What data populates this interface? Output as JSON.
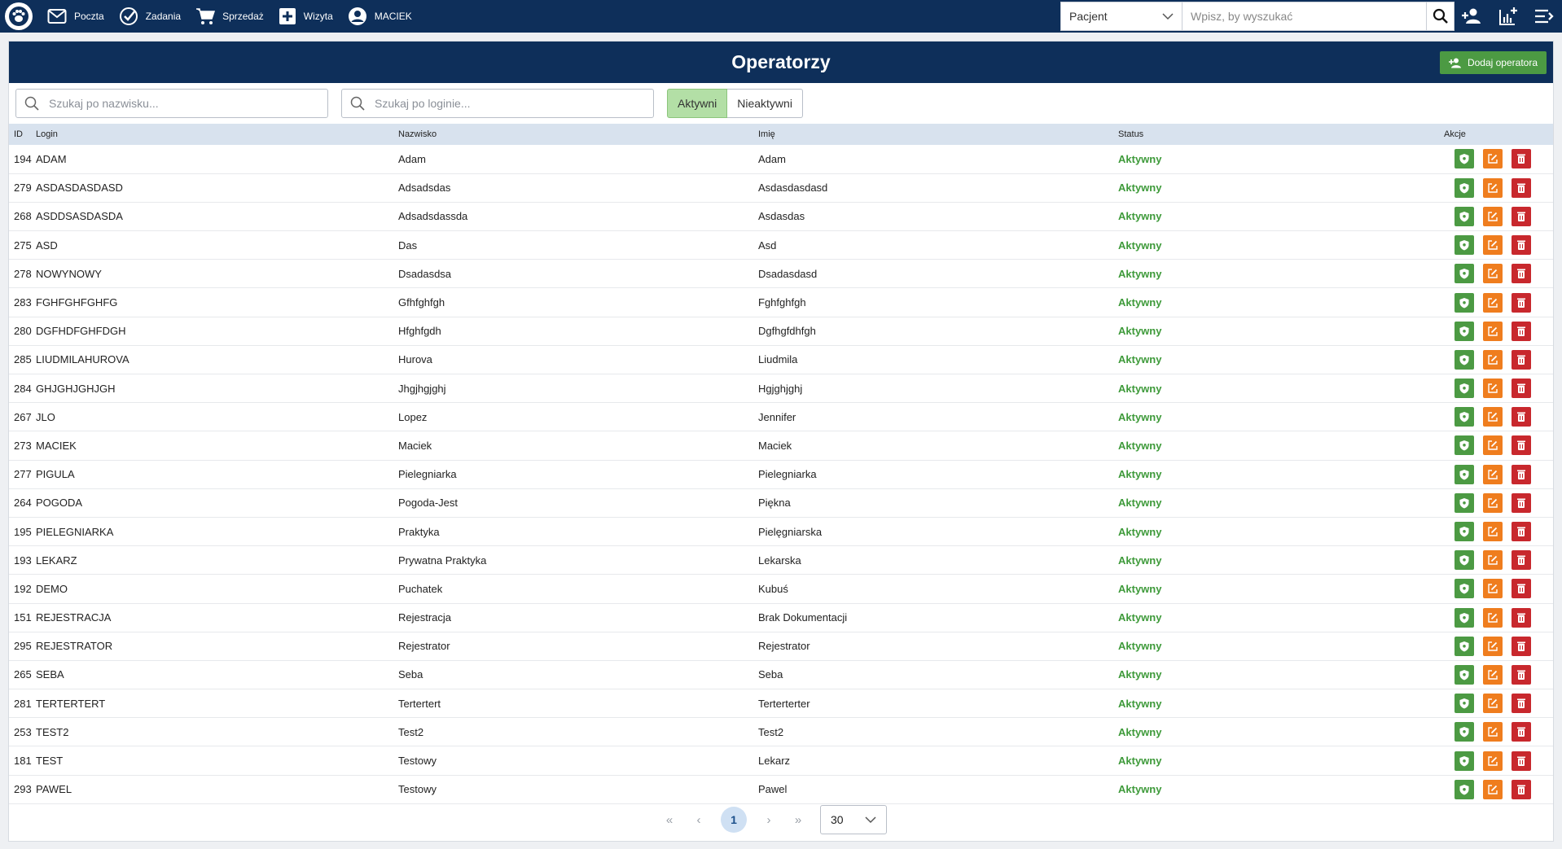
{
  "nav": {
    "items": [
      {
        "label": "Poczta",
        "icon": "mail-icon"
      },
      {
        "label": "Zadania",
        "icon": "check-circle-icon"
      },
      {
        "label": "Sprzedaż",
        "icon": "cart-icon"
      },
      {
        "label": "Wizyta",
        "icon": "plus-square-icon"
      },
      {
        "label": "MACIEK",
        "icon": "user-circle-icon"
      }
    ],
    "patient_select": "Pacjent",
    "search_placeholder": "Wpisz, by wyszukać"
  },
  "page": {
    "title": "Operatorzy",
    "add_button": "Dodaj operatora"
  },
  "filters": {
    "surname_placeholder": "Szukaj po nazwisku...",
    "login_placeholder": "Szukaj po loginie...",
    "active_label": "Aktywni",
    "inactive_label": "Nieaktywni"
  },
  "table": {
    "headers": {
      "id": "ID",
      "login": "Login",
      "surname": "Nazwisko",
      "first_name": "Imię",
      "status": "Status",
      "actions": "Akcje"
    },
    "rows": [
      {
        "id": "194",
        "login": "ADAM",
        "surname": "Adam",
        "first_name": "Adam",
        "status": "Aktywny"
      },
      {
        "id": "279",
        "login": "ASDASDASDASD",
        "surname": "Adsadsdas",
        "first_name": "Asdasdasdasd",
        "status": "Aktywny"
      },
      {
        "id": "268",
        "login": "ASDDSASDASDA",
        "surname": "Adsadsdassda",
        "first_name": "Asdasdas",
        "status": "Aktywny"
      },
      {
        "id": "275",
        "login": "ASD",
        "surname": "Das",
        "first_name": "Asd",
        "status": "Aktywny"
      },
      {
        "id": "278",
        "login": "NOWYNOWY",
        "surname": "Dsadasdsa",
        "first_name": "Dsadasdasd",
        "status": "Aktywny"
      },
      {
        "id": "283",
        "login": "FGHFGHFGHFG",
        "surname": "Gfhfghfgh",
        "first_name": "Fghfghfgh",
        "status": "Aktywny"
      },
      {
        "id": "280",
        "login": "DGFHDFGHFDGH",
        "surname": "Hfghfgdh",
        "first_name": "Dgfhgfdhfgh",
        "status": "Aktywny"
      },
      {
        "id": "285",
        "login": "LIUDMILAHUROVA",
        "surname": "Hurova",
        "first_name": "Liudmila",
        "status": "Aktywny"
      },
      {
        "id": "284",
        "login": "GHJGHJGHJGH",
        "surname": "Jhgjhgjghj",
        "first_name": "Hgjghjghj",
        "status": "Aktywny"
      },
      {
        "id": "267",
        "login": "JLO",
        "surname": "Lopez",
        "first_name": "Jennifer",
        "status": "Aktywny"
      },
      {
        "id": "273",
        "login": "MACIEK",
        "surname": "Maciek",
        "first_name": "Maciek",
        "status": "Aktywny"
      },
      {
        "id": "277",
        "login": "PIGULA",
        "surname": "Pielegniarka",
        "first_name": "Pielegniarka",
        "status": "Aktywny"
      },
      {
        "id": "264",
        "login": "POGODA",
        "surname": "Pogoda-Jest",
        "first_name": "Piękna",
        "status": "Aktywny"
      },
      {
        "id": "195",
        "login": "PIELEGNIARKA",
        "surname": "Praktyka",
        "first_name": "Pielęgniarska",
        "status": "Aktywny"
      },
      {
        "id": "193",
        "login": "LEKARZ",
        "surname": "Prywatna Praktyka",
        "first_name": "Lekarska",
        "status": "Aktywny"
      },
      {
        "id": "192",
        "login": "DEMO",
        "surname": "Puchatek",
        "first_name": "Kubuś",
        "status": "Aktywny"
      },
      {
        "id": "151",
        "login": "REJESTRACJA",
        "surname": "Rejestracja",
        "first_name": "Brak Dokumentacji",
        "status": "Aktywny"
      },
      {
        "id": "295",
        "login": "REJESTRATOR",
        "surname": "Rejestrator",
        "first_name": "Rejestrator",
        "status": "Aktywny"
      },
      {
        "id": "265",
        "login": "SEBA",
        "surname": "Seba",
        "first_name": "Seba",
        "status": "Aktywny"
      },
      {
        "id": "281",
        "login": "TERTERTERT",
        "surname": "Tertertert",
        "first_name": "Terterterter",
        "status": "Aktywny"
      },
      {
        "id": "253",
        "login": "TEST2",
        "surname": "Test2",
        "first_name": "Test2",
        "status": "Aktywny"
      },
      {
        "id": "181",
        "login": "TEST",
        "surname": "Testowy",
        "first_name": "Lekarz",
        "status": "Aktywny"
      },
      {
        "id": "293",
        "login": "PAWEL",
        "surname": "Testowy",
        "first_name": "Pawel",
        "status": "Aktywny"
      }
    ]
  },
  "pagination": {
    "first": "«",
    "prev": "‹",
    "current_page": "1",
    "next": "›",
    "last": "»",
    "page_size": "30"
  },
  "colors": {
    "navy": "#0e2f5a",
    "green": "#4c9a43",
    "orange": "#ef7d1e",
    "red": "#c8282d",
    "active_status": "#3e9a3a"
  }
}
